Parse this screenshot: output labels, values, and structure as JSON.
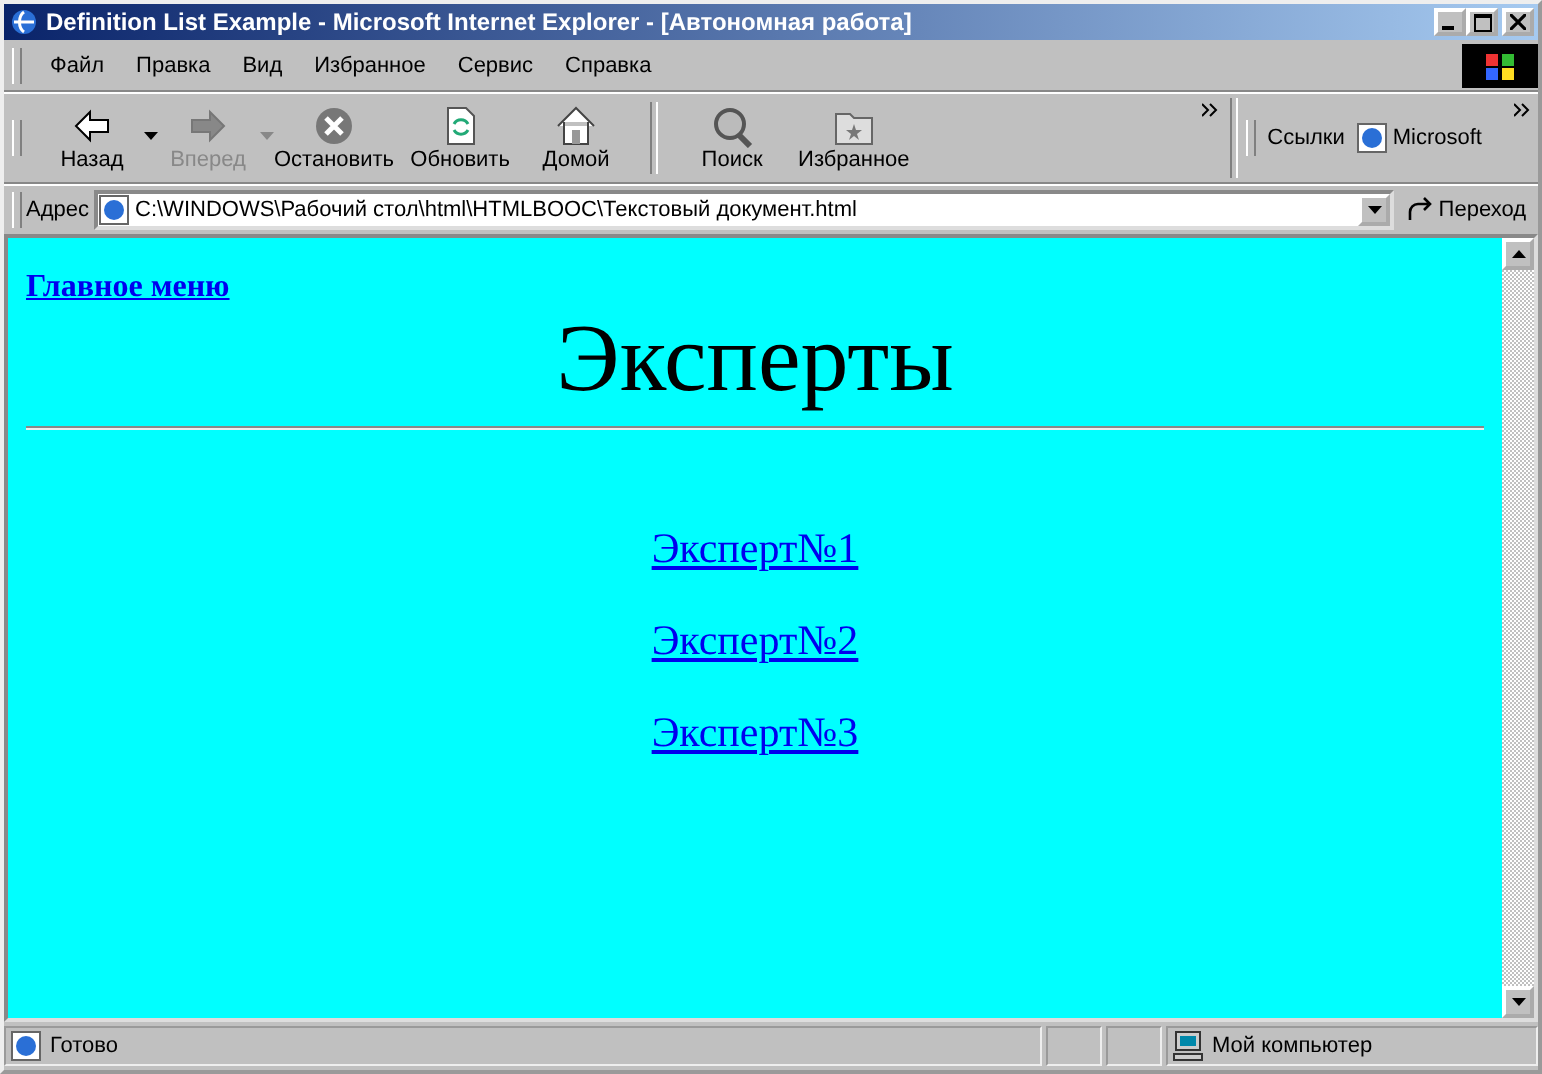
{
  "window": {
    "title": "Definition List Example - Microsoft Internet Explorer - [Автономная работа]"
  },
  "menu": [
    "Файл",
    "Правка",
    "Вид",
    "Избранное",
    "Сервис",
    "Справка"
  ],
  "toolbar": [
    {
      "label": "Назад",
      "disabled": false,
      "dropdown": true
    },
    {
      "label": "Вперед",
      "disabled": true,
      "dropdown": true
    },
    {
      "label": "Остановить",
      "disabled": false,
      "dropdown": false
    },
    {
      "label": "Обновить",
      "disabled": false,
      "dropdown": false
    },
    {
      "label": "Домой",
      "disabled": false,
      "dropdown": false
    },
    {
      "label": "Поиск",
      "disabled": false,
      "dropdown": false
    },
    {
      "label": "Избранное",
      "disabled": false,
      "dropdown": false
    }
  ],
  "links_bar": {
    "label": "Ссылки",
    "item": "Microsoft"
  },
  "address": {
    "label": "Адрес",
    "value": "C:\\WINDOWS\\Рабочий стол\\html\\HTMLBOOC\\Текстовый документ.html",
    "go": "Переход"
  },
  "page": {
    "top_link": "Главное меню",
    "heading": "Эксперты",
    "links": [
      "Эксперт№1",
      "Эксперт№2",
      "Эксперт№3"
    ]
  },
  "status_bar": {
    "text": "Готово",
    "zone": "Мой компьютер"
  }
}
